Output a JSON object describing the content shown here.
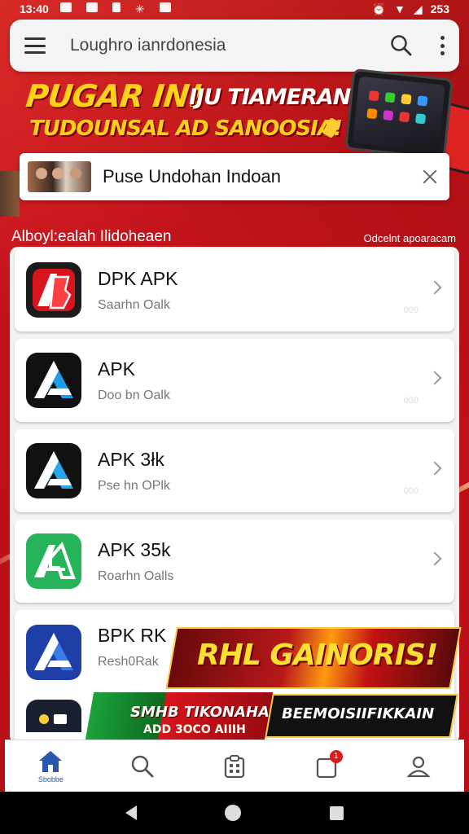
{
  "status_bar": {
    "time": "13:40",
    "battery": "253"
  },
  "search": {
    "query": "Loughro ianrdonesia"
  },
  "banner": {
    "line1": "PUGAR IN!",
    "line1b": "IJU TIAMERAN",
    "line2": "TUDOUNSAL AD SANOOSIA!"
  },
  "notice": {
    "text": "Puse Undohan Indoan"
  },
  "section": {
    "title": "Alboyl:ealah Ilidoheaen",
    "link": "Odcelnt apoaracam"
  },
  "apps": [
    {
      "name": "DPK APK",
      "sub": "Saarhn Oalk",
      "ghost": "000",
      "icon": "ab-logo-red-icon",
      "color": "#d8141c"
    },
    {
      "name": "APK",
      "sub": "Doo bn Oalk",
      "ghost": "000",
      "icon": "a-logo-blue-icon",
      "color": "#1e9ce8"
    },
    {
      "name": "APK 3łk",
      "sub": "Pse hn OPlk",
      "ghost": "000",
      "icon": "a-logo-blue-icon",
      "color": "#1e9ce8"
    },
    {
      "name": "APK 35k",
      "sub": "Roarhn Oalls",
      "icon": "ab-logo-green-icon",
      "color": "#27b35a"
    },
    {
      "name": "BPK RK",
      "sub": "Resh0Rak",
      "icon": "a-logo-navy-icon",
      "color": "#1e3fa8"
    }
  ],
  "promo": {
    "title": "RHL GAINORIS!",
    "left_line1": "SMHB TIKONAHAL",
    "left_line2": "ADD 3OCO AIIIH",
    "right": "BEEMOISIIFIKKAIN"
  },
  "bottom_nav": {
    "home_label": "Sbobbe",
    "notif_count": "1"
  }
}
